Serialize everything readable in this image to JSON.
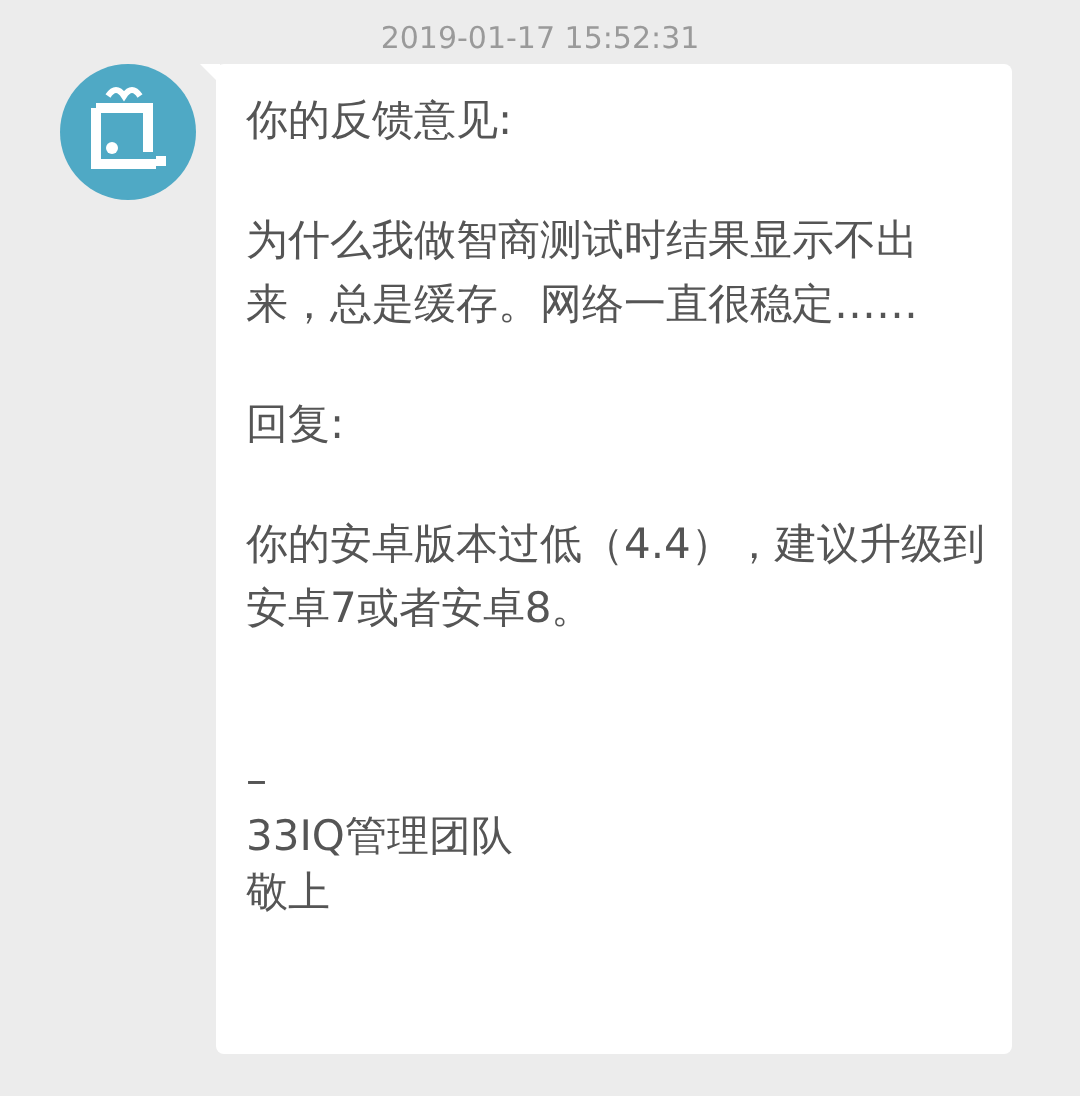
{
  "timestamp": "2019-01-17 15:52:31",
  "message": {
    "blocks": [
      {
        "kind": "label",
        "lines": [
          "你的反馈意见:"
        ]
      },
      {
        "kind": "text",
        "lines": [
          "为什么我做智商测试时结果显示不出来，总是缓存。网络一直很稳定……"
        ]
      },
      {
        "kind": "label",
        "lines": [
          "回复:"
        ]
      },
      {
        "kind": "text",
        "lines": [
          "你的安卓版本过低（4.4），建议升级到安卓7或者安卓8。"
        ]
      },
      {
        "kind": "signature",
        "lines": [
          "–",
          "33IQ管理团队",
          "敬上"
        ]
      }
    ]
  }
}
